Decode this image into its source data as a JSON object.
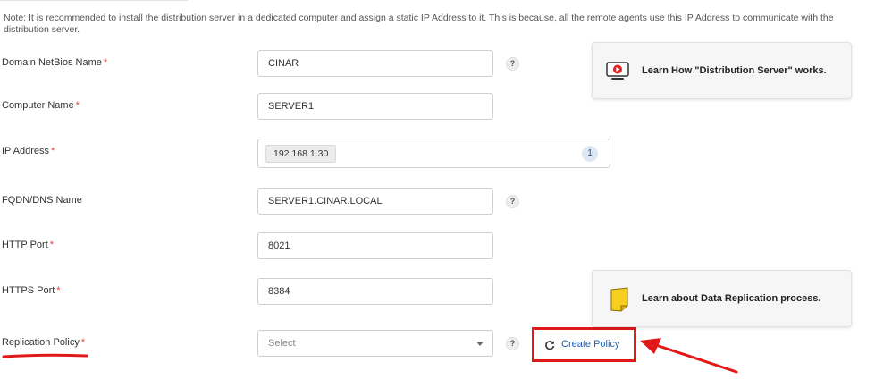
{
  "note": "Note: It is recommended to install the distribution server in a dedicated computer and assign a static IP Address to it. This is because, all the remote agents use this IP Address to communicate with the distribution server.",
  "required_marker": "*",
  "help_glyph": "?",
  "fields": {
    "domain": {
      "label": "Domain NetBios Name",
      "value": "CINAR"
    },
    "computer": {
      "label": "Computer Name",
      "value": "SERVER1"
    },
    "ip": {
      "label": "IP Address",
      "value": "192.168.1.30",
      "count": "1"
    },
    "fqdn": {
      "label": "FQDN/DNS Name",
      "value": "SERVER1.CINAR.LOCAL"
    },
    "http": {
      "label": "HTTP Port",
      "value": "8021"
    },
    "https": {
      "label": "HTTPS Port",
      "value": "8384"
    },
    "policy": {
      "label": "Replication Policy",
      "placeholder": "Select",
      "selected": "Select"
    }
  },
  "create_policy": {
    "label": "Create Policy",
    "icon": "refresh-icon"
  },
  "cards": {
    "distribution": {
      "text": "Learn How \"Distribution Server\" works.",
      "icon": "video-play-icon"
    },
    "replication": {
      "text": "Learn about Data Replication process.",
      "icon": "sticky-note-icon"
    }
  },
  "colors": {
    "required": "#e0453d",
    "link": "#1f5fa8",
    "annotation": "#e01818"
  }
}
